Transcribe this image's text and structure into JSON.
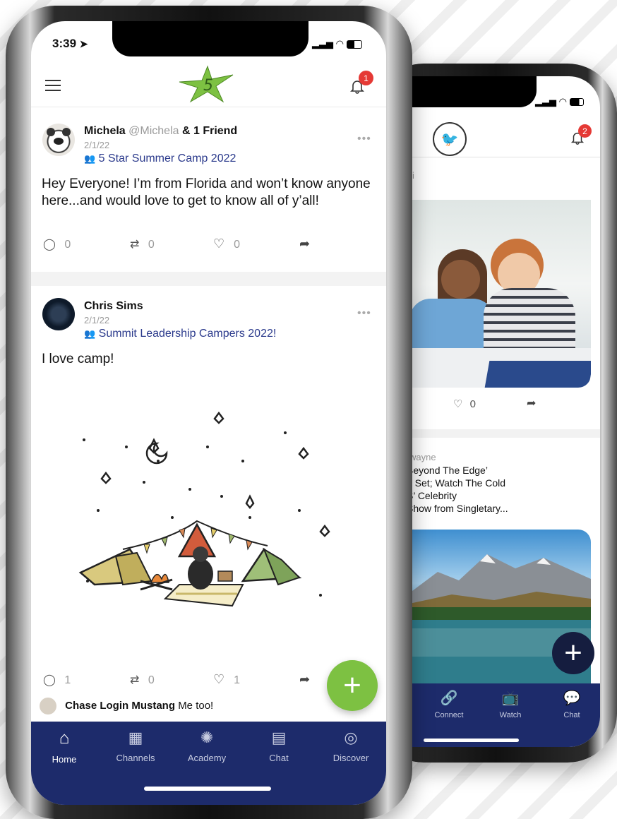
{
  "front": {
    "status_time": "3:39",
    "notification_count": "1",
    "posts": [
      {
        "author": "Michela",
        "handle": "@Michela",
        "with": "& 1 Friend",
        "date": "2/1/22",
        "group": "5 Star Summer Camp 2022",
        "text": "Hey Everyone! I’m from Florida and won’t know anyone here...and would love to get to know all of y’all!",
        "comments": "0",
        "reposts": "0",
        "likes": "0"
      },
      {
        "author": "Chris Sims",
        "date": "2/1/22",
        "group": "Summit Leadership Campers 2022!",
        "text": "I love camp!",
        "comments": "1",
        "reposts": "0",
        "likes": "1"
      }
    ],
    "comment_preview": {
      "author": "Chase Login Mustang",
      "text": "Me too!"
    },
    "nav": [
      {
        "label": "Home",
        "icon": "home-icon"
      },
      {
        "label": "Channels",
        "icon": "channels-icon"
      },
      {
        "label": "Academy",
        "icon": "lightbulb-icon"
      },
      {
        "label": "Chat",
        "icon": "chat-icon"
      },
      {
        "label": "Discover",
        "icon": "compass-icon"
      }
    ],
    "colors": {
      "accent": "#7dc142",
      "nav": "#1d2b6b",
      "badge": "#e53935",
      "link": "#2b3a8c"
    }
  },
  "back": {
    "notification_count": "2",
    "card1": {
      "partial_author": "i",
      "likes": "0"
    },
    "card2": {
      "author": "wayne",
      "lines": [
        "Beyond The Edge’",
        "e Set; Watch The Cold",
        "S’ Celebrity",
        "Show from Singletary..."
      ]
    },
    "nav": [
      {
        "label": "Connect",
        "icon": "link-icon"
      },
      {
        "label": "Watch",
        "icon": "tv-icon"
      },
      {
        "label": "Chat",
        "icon": "chat-icon"
      }
    ]
  }
}
